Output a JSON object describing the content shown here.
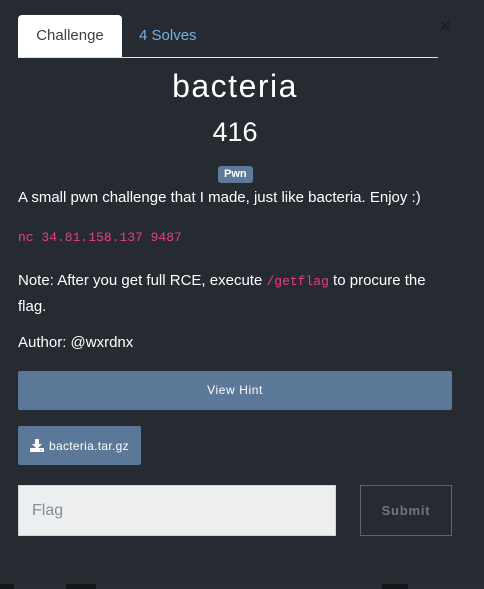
{
  "tabs": [
    {
      "label": "Challenge"
    },
    {
      "label": "4 Solves"
    }
  ],
  "close_glyph": "×",
  "challenge": {
    "name": "bacteria",
    "points": "416",
    "category": "Pwn",
    "description": "A small pwn challenge that I made, just like bacteria. Enjoy :)",
    "connection": "nc 34.81.158.137 9487",
    "note_prefix": "Note: After you get full RCE, execute ",
    "note_code": "/getflag",
    "note_suffix": " to procure the flag.",
    "author": "Author: @wxrdnx"
  },
  "hint_button": {
    "label": "View Hint"
  },
  "file": {
    "name": "bacteria.tar.gz",
    "icon": "download-icon"
  },
  "flag_input": {
    "placeholder": "Flag",
    "value": ""
  },
  "submit_button": {
    "label": "Submit"
  },
  "colors": {
    "modal_bg": "#262a31",
    "accent_button": "#5c7899",
    "tab_link": "#78b1e6",
    "code": "#e83e8c",
    "tag_bg": "#5e7a9a"
  }
}
